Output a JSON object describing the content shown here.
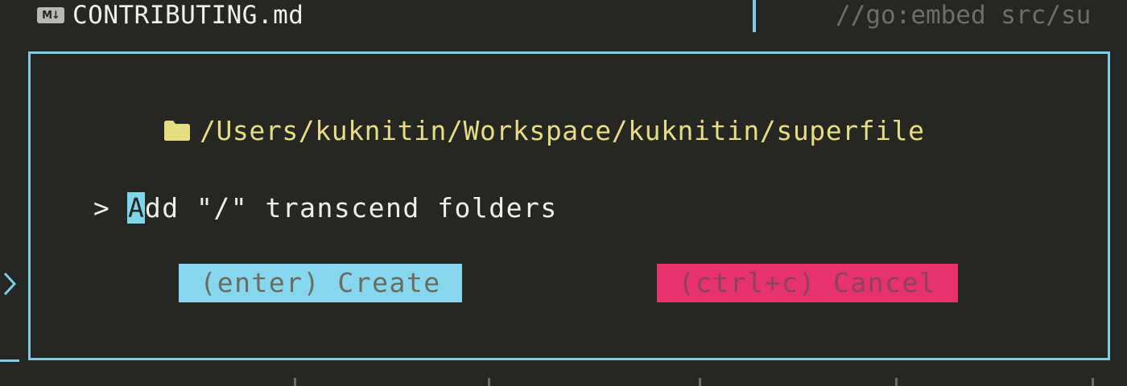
{
  "background": {
    "file_icon": "markdown-icon",
    "file_icon_text": "M↓",
    "file_name": "CONTRIBUTING.md",
    "code_snippet": "//go:embed src/su"
  },
  "modal": {
    "folder_icon": "folder-icon",
    "path": "/Users/kuknitin/Workspace/kuknitin/superfile",
    "input": {
      "prompt": ">",
      "cursor_char": "A",
      "value_rest": "dd \"/\" transcend folders"
    },
    "buttons": {
      "create_label": "(enter) Create",
      "cancel_label": "(ctrl+c) Cancel"
    }
  },
  "colors": {
    "background": "#262622",
    "accent": "#7fcbe6",
    "path": "#e6dc82",
    "create_bg": "#86d7ee",
    "cancel_bg": "#e6336f"
  }
}
